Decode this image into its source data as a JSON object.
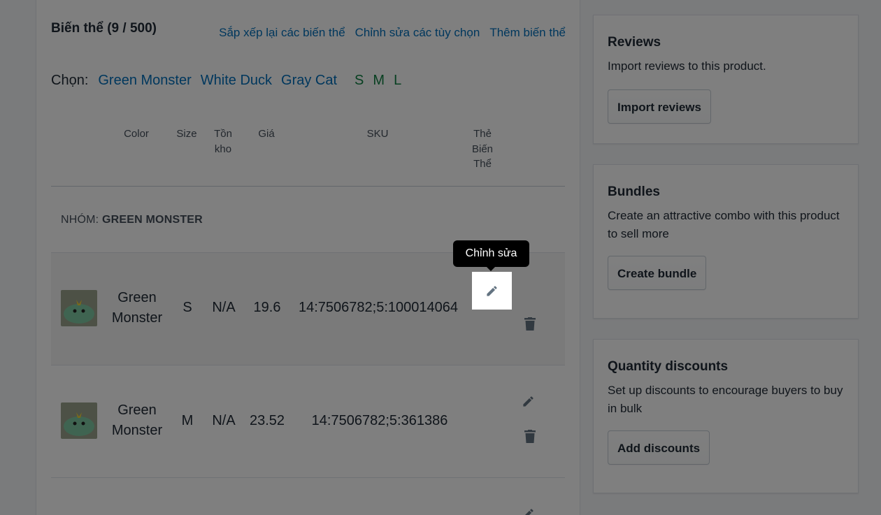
{
  "variants": {
    "title": "Biến thể (9 / 500)",
    "links": [
      "Sắp xếp lại các biến thể",
      "Chỉnh sửa các tùy chọn",
      "Thêm biến thể"
    ],
    "select_label": "Chọn:",
    "select_colors": [
      "Green Monster",
      "White Duck",
      "Gray Cat"
    ],
    "select_sizes": [
      "S",
      "M",
      "L"
    ],
    "columns": {
      "color": "Color",
      "size": "Size",
      "stock": "Tồn kho",
      "price": "Giá",
      "sku": "SKU",
      "variant_tag": "Thẻ Biến Thể"
    },
    "group_prefix": "NHÓM:",
    "group_name": "GREEN MONSTER",
    "rows": [
      {
        "color": "Green Monster",
        "size": "S",
        "stock": "N/A",
        "price": "19.6",
        "sku": "14:7506782;5:100014064"
      },
      {
        "color": "Green Monster",
        "size": "M",
        "stock": "N/A",
        "price": "23.52",
        "sku": "14:7506782;5:361386"
      }
    ],
    "tooltip": "Chỉnh sửa"
  },
  "sidebar": {
    "reviews": {
      "title": "Reviews",
      "text": "Import reviews to this product.",
      "button": "Import reviews"
    },
    "bundles": {
      "title": "Bundles",
      "text": "Create an attractive combo with this product to sell more",
      "button": "Create bundle"
    },
    "discounts": {
      "title": "Quantity discounts",
      "text": "Set up discounts to encourage buyers to buy in bulk",
      "button": "Add discounts"
    }
  },
  "colors": {
    "link": "#006fbb",
    "size_option": "#108043",
    "overlay": "rgba(0,0,0,0.5)"
  },
  "icons": [
    "pencil-icon",
    "trash-icon"
  ]
}
